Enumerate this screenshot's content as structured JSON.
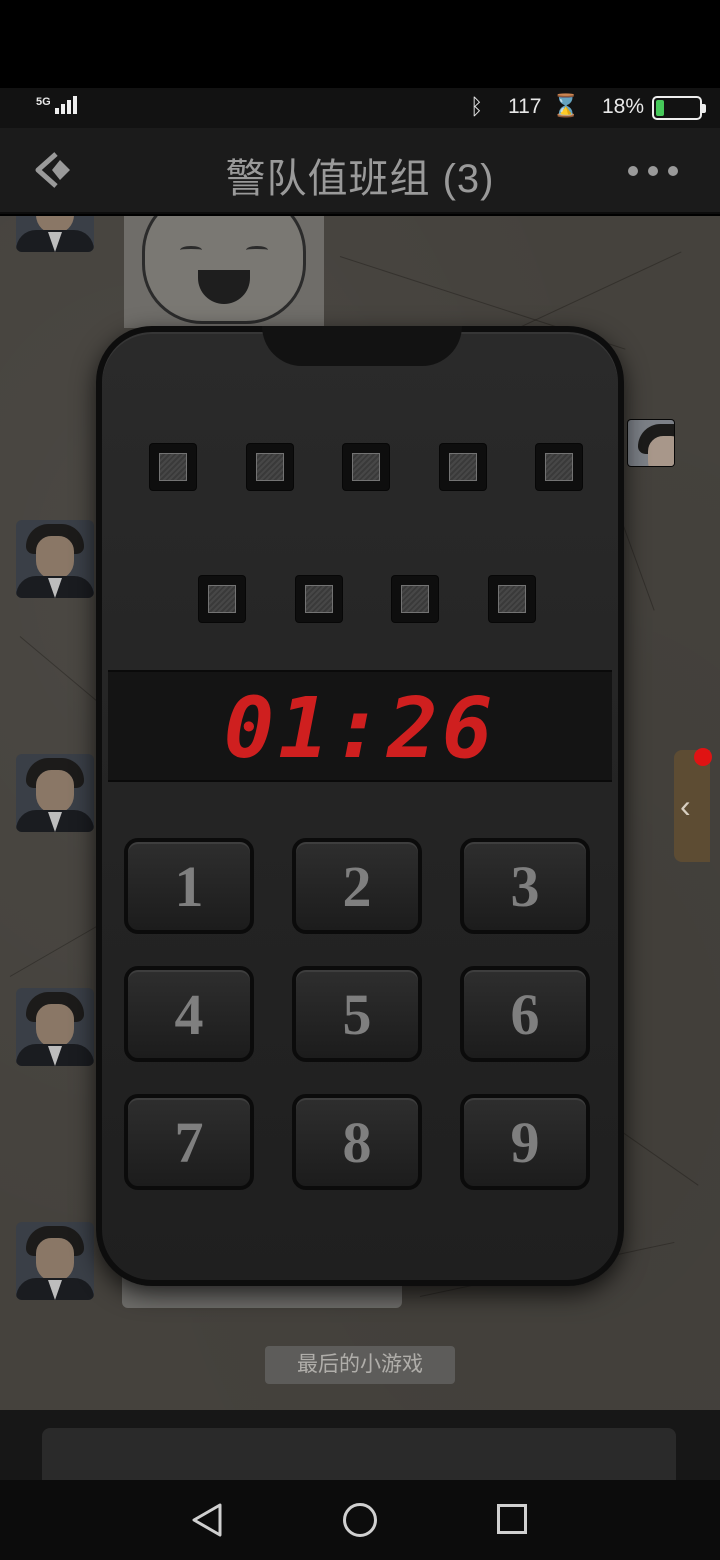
{
  "status_bar": {
    "network": "5G",
    "net_speed": "117",
    "battery_percent": "18%",
    "battery_level": 0.18
  },
  "header": {
    "title": "警队值班组 (3)"
  },
  "chat": {
    "system_tag": "最后的小游戏"
  },
  "puzzle": {
    "timer": "01:26",
    "lights_row1_count": 5,
    "lights_row2_count": 4,
    "keys": [
      "1",
      "2",
      "3",
      "4",
      "5",
      "6",
      "7",
      "8",
      "9"
    ]
  },
  "colors": {
    "timer": "#cf1f1f",
    "notification_dot": "#e01313",
    "battery": "#46c85a"
  }
}
